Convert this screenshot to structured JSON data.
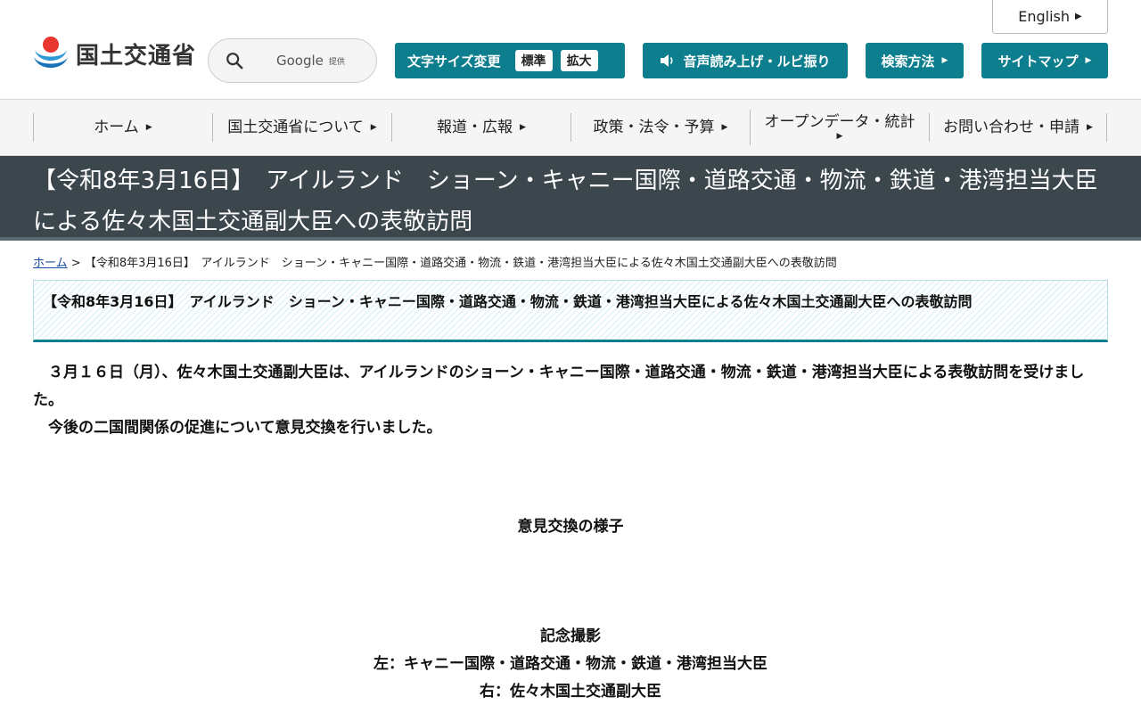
{
  "header": {
    "english_label": "English",
    "logo_text": "国土交通省",
    "search": {
      "brand": "Google",
      "brand_sub": "提供"
    },
    "font_size": {
      "label": "文字サイズ変更",
      "standard": "標準",
      "large": "拡大"
    },
    "voice_label": "音声読み上げ・ルビ振り",
    "search_method_label": "検索方法",
    "sitemap_label": "サイトマップ"
  },
  "nav": {
    "items": [
      {
        "label": "ホーム"
      },
      {
        "label": "国土交通省について"
      },
      {
        "label": "報道・広報"
      },
      {
        "label": "政策・法令・予算"
      },
      {
        "label": "オープンデータ・統計"
      },
      {
        "label": "お問い合わせ・申請"
      }
    ]
  },
  "page": {
    "title": "【令和8年3月16日】　アイルランド　ショーン・キャニー国際・道路交通・物流・鉄道・港湾担当大臣による佐々木国土交通副大臣への表敬訪問",
    "breadcrumb_home": "ホーム",
    "breadcrumb_sep": ">",
    "breadcrumb_current": "【令和8年3月16日】　アイルランド　ショーン・キャニー国際・道路交通・物流・鉄道・港湾担当大臣による佐々木国土交通副大臣への表敬訪問",
    "heading": "【令和8年3月16日】　アイルランド　ショーン・キャニー国際・道路交通・物流・鉄道・港湾担当大臣による佐々木国土交通副大臣への表敬訪問",
    "para1": "３月１６日（月）、佐々木国土交通副大臣は、アイルランドのショーン・キャニー国際・道路交通・物流・鉄道・港湾担当大臣による表敬訪問を受けました。",
    "para2": "今後の二国間関係の促進について意見交換を行いました。",
    "caption1": "意見交換の様子",
    "caption2_title": "記念撮影",
    "caption2_left": "左：キャニー国際・道路交通・物流・鉄道・港湾担当大臣",
    "caption2_right": "右：佐々木国土交通副大臣"
  },
  "colors": {
    "accent": "#0d7e8e",
    "title_band": "#3b474d",
    "link": "#1a4ea0"
  }
}
